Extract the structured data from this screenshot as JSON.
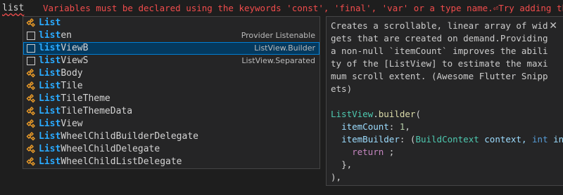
{
  "editor": {
    "typed_word": "list",
    "error_message": "Variables must be declared using the keywords 'const', 'final', 'var' or a type name.⏎Try adding the na"
  },
  "suggestions": {
    "items": [
      {
        "match": "List",
        "rest": "",
        "detail": "",
        "icon": "class-icon"
      },
      {
        "match": "list",
        "rest": "en",
        "detail": "Provider Listenable",
        "icon": "snippet-icon"
      },
      {
        "match": "list",
        "rest": "ViewB",
        "detail": "ListView.Builder",
        "icon": "snippet-icon"
      },
      {
        "match": "list",
        "rest": "ViewS",
        "detail": "ListView.Separated",
        "icon": "snippet-icon"
      },
      {
        "match": "List",
        "rest": "Body",
        "detail": "",
        "icon": "class-icon"
      },
      {
        "match": "List",
        "rest": "Tile",
        "detail": "",
        "icon": "class-icon"
      },
      {
        "match": "List",
        "rest": "TileTheme",
        "detail": "",
        "icon": "class-icon"
      },
      {
        "match": "List",
        "rest": "TileThemeData",
        "detail": "",
        "icon": "class-icon"
      },
      {
        "match": "List",
        "rest": "View",
        "detail": "",
        "icon": "class-icon"
      },
      {
        "match": "List",
        "rest": "WheelChildBuilderDelegate",
        "detail": "",
        "icon": "class-icon"
      },
      {
        "match": "List",
        "rest": "WheelChildDelegate",
        "detail": "",
        "icon": "class-icon"
      },
      {
        "match": "List",
        "rest": "WheelChildListDelegate",
        "detail": "",
        "icon": "class-icon"
      }
    ]
  },
  "details": {
    "close_glyph": "✕",
    "doc_lines": [
      "Creates a scrollable, linear array of wid",
      "gets that are created on demand.Providing",
      "a non-null `itemCount` improves the abili",
      "ty of the [ListView] to estimate the maxi",
      "mum scroll extent. (Awesome Flutter Snipp",
      "ets)"
    ],
    "code": {
      "line1_class": "ListView",
      "line1_dot": ".",
      "line1_fn": "builder",
      "line1_paren": "(",
      "line2_param": "itemCount",
      "line2_colon": ": ",
      "line2_num": "1",
      "line2_comma": ",",
      "line3_param": "itemBuilder",
      "line3_colon": ": (",
      "line3_type": "BuildContext",
      "line3_ctx": " context, ",
      "line3_int": "int",
      "line3_rest": " ind",
      "line4_kw": "return",
      "line4_rest": " ;",
      "line5": "},",
      "line6": "),"
    }
  },
  "colors": {
    "background": "#1e1e1e",
    "widget_bg": "#252526",
    "selection_bg": "#04395e",
    "match_highlight": "#2aaaff",
    "error": "#f14c4c",
    "class_icon": "#ee9d28"
  }
}
